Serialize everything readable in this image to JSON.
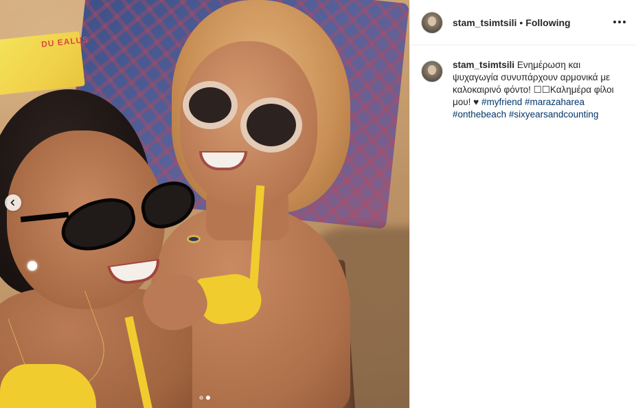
{
  "post": {
    "username": "stam_tsimtsili",
    "separator": "•",
    "follow_status": "Following",
    "carousel": {
      "total": 2,
      "active": 2
    },
    "towel_text": "DU EALUS"
  },
  "caption": {
    "username": "stam_tsimtsili",
    "text": "Ενημέρωση και ψυχαγωγία συνυπάρχουν αρμονικά με καλοκαιρινό φόντο! ☐☐Καλημέρα φίλοι μου! ♥",
    "hashtags": [
      "#myfriend",
      "#marazaharea",
      "#onthebeach",
      "#sixyearsandcounting"
    ]
  },
  "icons": {
    "prev": "chevron-left-icon",
    "more": "more-options-icon"
  }
}
